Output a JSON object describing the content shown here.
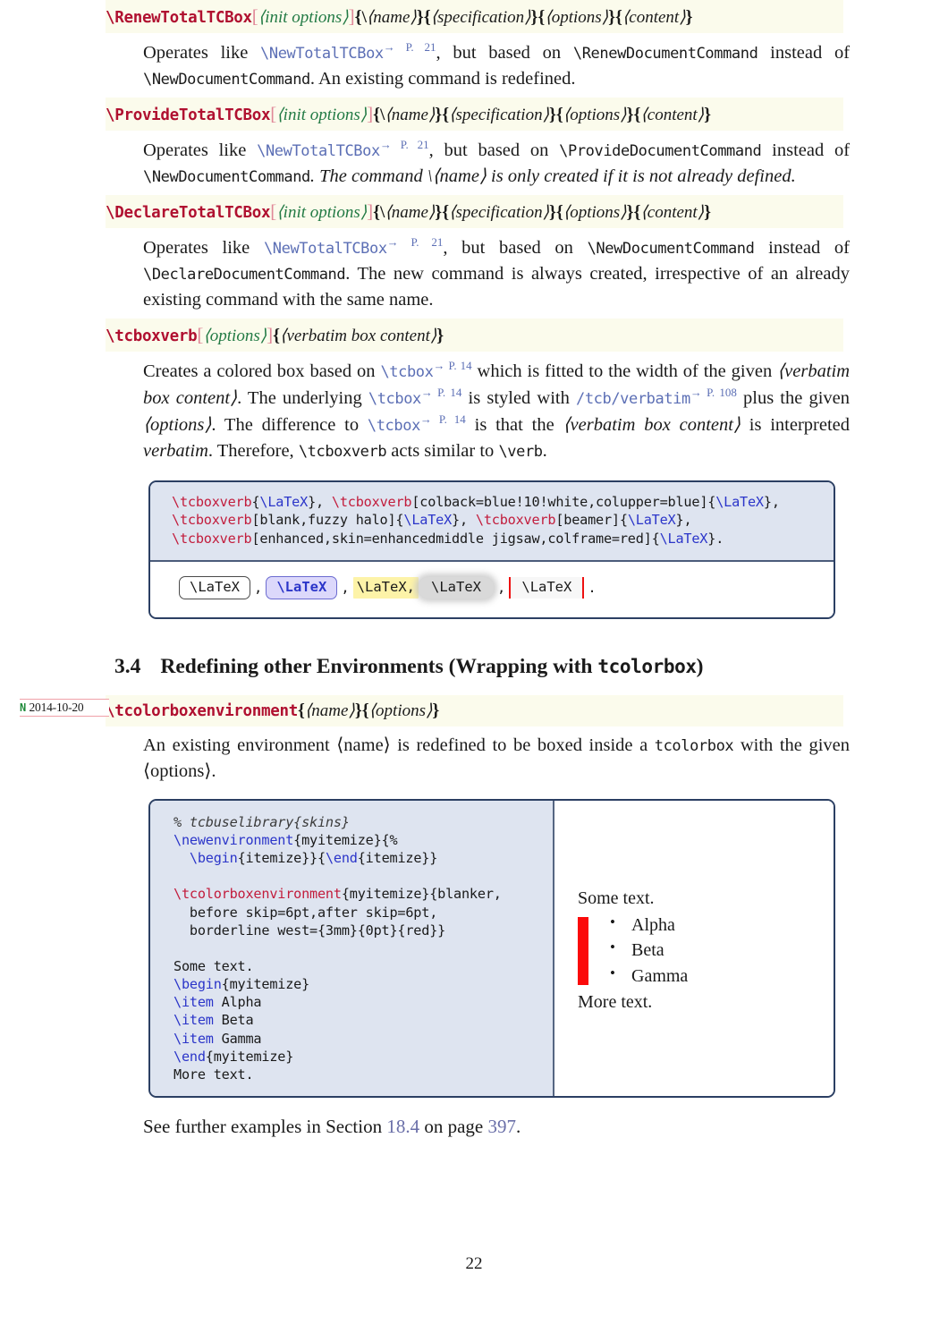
{
  "page_number": "22",
  "commands": [
    {
      "name": "\\RenewTotalTCBox",
      "optional_arg": "init options",
      "mandatory_args": [
        "\\⟨name⟩",
        "specification",
        "options",
        "content"
      ],
      "description_parts": {
        "lead": "Operates like",
        "link": "\\NewTotalTCBox",
        "pageref": "→ P. 21",
        "mid": ", but based on",
        "basis": "\\RenewDocumentCommand",
        "tail": "instead of",
        "basis2": "\\NewDocumentCommand",
        "rest": ". An existing command is redefined."
      }
    },
    {
      "name": "\\ProvideTotalTCBox",
      "optional_arg": "init options",
      "mandatory_args": [
        "\\⟨name⟩",
        "specification",
        "options",
        "content"
      ],
      "description_parts": {
        "lead": "Operates like",
        "link": "\\NewTotalTCBox",
        "pageref": "→ P. 21",
        "mid": ", but based on",
        "basis": "\\ProvideDocumentCommand",
        "tail": "instead of",
        "basis2": "\\NewDocumentCommand",
        "rest": ". The command \\⟨name⟩ is only created if it is not already defined."
      }
    },
    {
      "name": "\\DeclareTotalTCBox",
      "optional_arg": "init options",
      "mandatory_args": [
        "\\⟨name⟩",
        "specification",
        "options",
        "content"
      ],
      "description_parts": {
        "lead": "Operates like",
        "link": "\\NewTotalTCBox",
        "pageref": "→ P. 21",
        "mid": ", but based on",
        "basis": "\\NewDocumentCommand",
        "tail": "instead of",
        "basis2": "\\DeclareDocumentCommand",
        "rest": ". The new command is always created, irrespective of an already existing command with the same name."
      }
    }
  ],
  "tcboxverb": {
    "name": "\\tcboxverb",
    "optional_arg": "options",
    "mandatory_arg": "verbatim box content",
    "desc": {
      "p1": "Creates a colored box based on",
      "tcbox1": "\\tcbox",
      "ref1": "→ P. 14",
      "p2": "which is fitted to the width of the given",
      "vbc": "⟨verbatim box content⟩",
      "p3": ". The underlying",
      "tcbox2": "\\tcbox",
      "ref2": "→ P. 14",
      "p4": "is styled with",
      "verbatimkey": "/tcb/verbatim",
      "ref3": "→ P. 108",
      "p5": "plus the given",
      "opts": "⟨options⟩",
      "p6": ". The difference to",
      "tcbox3": "\\tcbox",
      "ref4": "→ P. 14",
      "p7": "is that the",
      "vbc2": "⟨verbatim box content⟩",
      "p8": "is interpreted",
      "verbatimword": "verbatim",
      "p9": ". Therefore,",
      "tcboxverbword": "\\tcboxverb",
      "p10": "acts similar to",
      "verbword": "\\verb",
      "p11": "."
    }
  },
  "example1": {
    "code_lines": [
      [
        {
          "t": "\\tcboxverb",
          "c": "red"
        },
        {
          "t": "{",
          "c": "plain"
        },
        {
          "t": "\\LaTeX",
          "c": "blue"
        },
        {
          "t": "}, ",
          "c": "plain"
        },
        {
          "t": "\\tcboxverb",
          "c": "red"
        },
        {
          "t": "[colback=blue!10!white,colupper=blue]{",
          "c": "plain"
        },
        {
          "t": "\\LaTeX",
          "c": "blue"
        },
        {
          "t": "},",
          "c": "plain"
        }
      ],
      [
        {
          "t": "\\tcboxverb",
          "c": "red"
        },
        {
          "t": "[blank,fuzzy halo]{",
          "c": "plain"
        },
        {
          "t": "\\LaTeX",
          "c": "blue"
        },
        {
          "t": "}, ",
          "c": "plain"
        },
        {
          "t": "\\tcboxverb",
          "c": "red"
        },
        {
          "t": "[beamer]{",
          "c": "plain"
        },
        {
          "t": "\\LaTeX",
          "c": "blue"
        },
        {
          "t": "},",
          "c": "plain"
        }
      ],
      [
        {
          "t": "\\tcboxverb",
          "c": "red"
        },
        {
          "t": "[enhanced,skin=enhancedmiddle jigsaw,colframe=red]{",
          "c": "plain"
        },
        {
          "t": "\\LaTeX",
          "c": "blue"
        },
        {
          "t": "}.",
          "c": "plain"
        }
      ]
    ],
    "result_chips": [
      {
        "label": "\\LaTeX",
        "style": "plain",
        "after": ","
      },
      {
        "label": "\\LaTeX",
        "style": "blue",
        "after": ","
      },
      {
        "label": "\\LaTeX,",
        "style": "yellow",
        "after": ""
      },
      {
        "label": "\\LaTeX",
        "style": "fuzzy",
        "after": ","
      },
      {
        "label": "\\LaTeX",
        "style": "jigsaw",
        "after": "."
      }
    ]
  },
  "section": {
    "number": "3.4",
    "title_before": "Redefining other Environments (Wrapping with ",
    "title_code": "tcolorbox",
    "title_after": ")"
  },
  "margin_note": {
    "flag": "N",
    "date": "2014-10-20"
  },
  "tcolorboxenvironment": {
    "name": "\\tcolorboxenvironment",
    "args": [
      "name",
      "options"
    ],
    "desc_before": "An existing environment ⟨name⟩ is redefined to be boxed inside a ",
    "desc_code": "tcolorbox",
    "desc_after": " with the given ⟨options⟩."
  },
  "example2": {
    "code_lines": [
      [
        {
          "t": "% tcbuselibrary{skins}",
          "c": "comment"
        }
      ],
      [
        {
          "t": "\\newenvironment",
          "c": "blue"
        },
        {
          "t": "{myitemize}{%",
          "c": "plain"
        }
      ],
      [
        {
          "t": "  ",
          "c": "plain"
        },
        {
          "t": "\\begin",
          "c": "blue"
        },
        {
          "t": "{itemize}}{",
          "c": "plain"
        },
        {
          "t": "\\end",
          "c": "blue"
        },
        {
          "t": "{itemize}}",
          "c": "plain"
        }
      ],
      [
        {
          "t": "",
          "c": "plain"
        }
      ],
      [
        {
          "t": "\\tcolorboxenvironment",
          "c": "red"
        },
        {
          "t": "{myitemize}{blanker,",
          "c": "plain"
        }
      ],
      [
        {
          "t": "  before skip=6pt,after skip=6pt,",
          "c": "plain"
        }
      ],
      [
        {
          "t": "  borderline west={3mm}{0pt}{red}}",
          "c": "plain"
        }
      ],
      [
        {
          "t": "",
          "c": "plain"
        }
      ],
      [
        {
          "t": "Some text.",
          "c": "plain"
        }
      ],
      [
        {
          "t": "\\begin",
          "c": "blue"
        },
        {
          "t": "{myitemize}",
          "c": "plain"
        }
      ],
      [
        {
          "t": "\\item",
          "c": "blue"
        },
        {
          "t": " Alpha",
          "c": "plain"
        }
      ],
      [
        {
          "t": "\\item",
          "c": "blue"
        },
        {
          "t": " Beta",
          "c": "plain"
        }
      ],
      [
        {
          "t": "\\item",
          "c": "blue"
        },
        {
          "t": " Gamma",
          "c": "plain"
        }
      ],
      [
        {
          "t": "\\end",
          "c": "blue"
        },
        {
          "t": "{myitemize}",
          "c": "plain"
        }
      ],
      [
        {
          "t": "More text.",
          "c": "plain"
        }
      ]
    ],
    "output": {
      "before_text": "Some text.",
      "items": [
        "Alpha",
        "Beta",
        "Gamma"
      ],
      "after_text": "More text.",
      "borderline_color": "#fb0a0a"
    }
  },
  "footer_note": {
    "before": "See further examples in Section ",
    "section_link": "18.4",
    "middle": " on page ",
    "page_link": "397",
    "after": "."
  },
  "colors": {
    "cmd_name": "#b01030",
    "opt_arg": "#227a44",
    "link": "#5c6fb5",
    "code_bg": "#dee4f0",
    "box_border": "#2b3f63",
    "cmd_bar_bg": "#fbfbec",
    "margin_note_rule": "#f0a0a8",
    "margin_note_flag": "#1f8a3a"
  }
}
